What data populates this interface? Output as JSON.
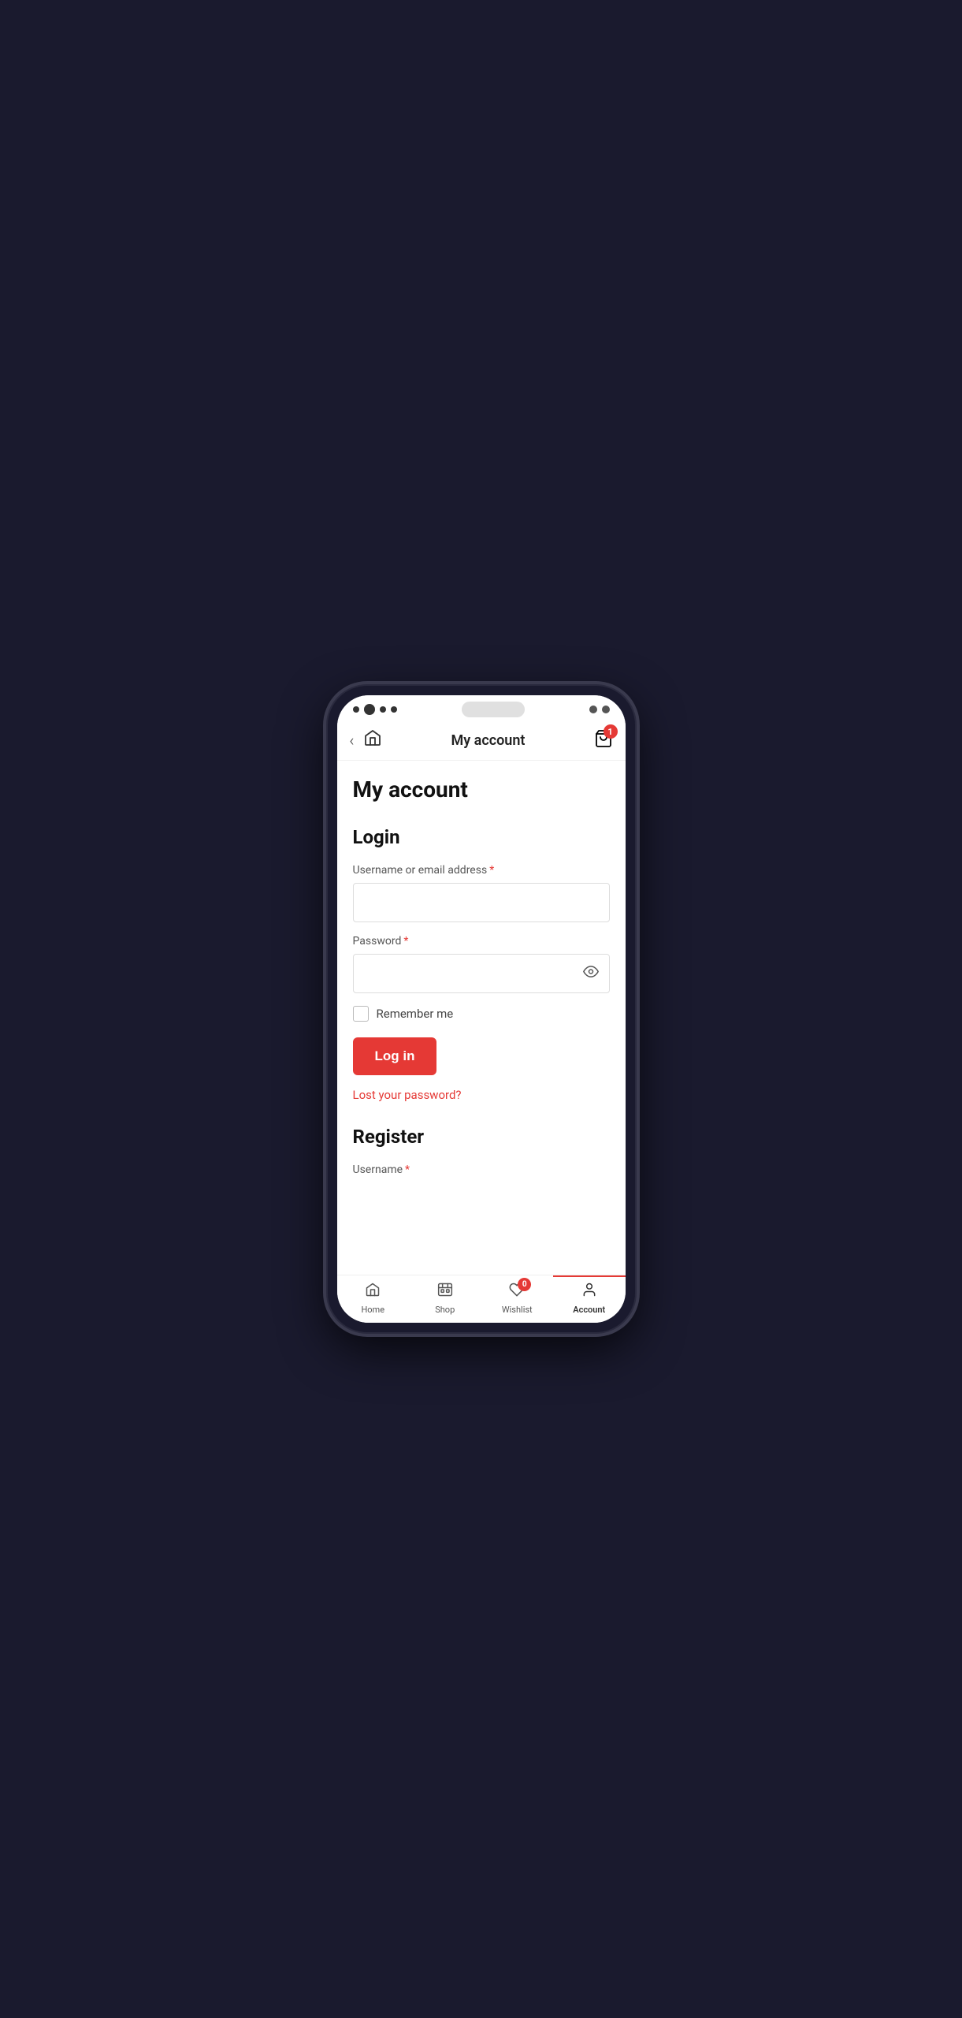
{
  "statusBar": {
    "cartBadge": "1"
  },
  "topNav": {
    "title": "My account",
    "backLabel": "‹",
    "cartCount": "1"
  },
  "page": {
    "heading": "My account"
  },
  "loginSection": {
    "title": "Login",
    "usernameLabel": "Username or email address",
    "usernamePlaceholder": "",
    "passwordLabel": "Password",
    "passwordPlaceholder": "",
    "rememberLabel": "Remember me",
    "loginButtonLabel": "Log in",
    "lostPasswordLabel": "Lost your password?"
  },
  "registerSection": {
    "title": "Register",
    "usernameLabel": "Username"
  },
  "bottomNav": {
    "items": [
      {
        "id": "home",
        "label": "Home",
        "badge": null,
        "active": false
      },
      {
        "id": "shop",
        "label": "Shop",
        "badge": null,
        "active": false
      },
      {
        "id": "wishlist",
        "label": "Wishlist",
        "badge": "0",
        "active": false
      },
      {
        "id": "account",
        "label": "Account",
        "badge": null,
        "active": true
      }
    ]
  }
}
